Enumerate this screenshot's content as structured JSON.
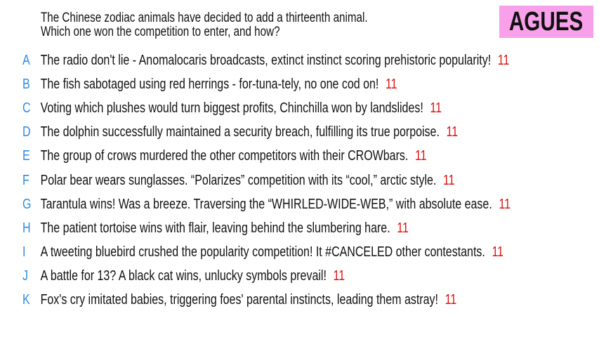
{
  "question": {
    "line1": "The Chinese zodiac animals have decided to add a thirteenth animal.",
    "line2": "Which one won the competition to enter, and how?"
  },
  "badge": {
    "label": "AGUES",
    "color": "#f8a0ea"
  },
  "colors": {
    "letter": "#2e8ae6",
    "score": "#e01010"
  },
  "answers": [
    {
      "letter": "A",
      "text": "The radio don't lie - Anomalocaris broadcasts, extinct instinct scoring prehistoric popularity!",
      "score": "11"
    },
    {
      "letter": "B",
      "text": "The fish sabotaged using red herrings - for-tuna-tely, no one cod on!",
      "score": "11"
    },
    {
      "letter": "C",
      "text": "Voting which plushes would turn biggest profits, Chinchilla won by landslides!",
      "score": "11"
    },
    {
      "letter": "D",
      "text": "The dolphin successfully maintained a security breach, fulfilling its true porpoise.",
      "score": "11"
    },
    {
      "letter": "E",
      "text": "The group of crows murdered the other competitors with their CROWbars.",
      "score": "11"
    },
    {
      "letter": "F",
      "text": "Polar bear wears sunglasses. “Polarizes” competition with its “cool,” arctic style.",
      "score": "11"
    },
    {
      "letter": "G",
      "text": "Tarantula wins! Was a breeze. Traversing the “WHIRLED-WIDE-WEB,” with absolute ease.",
      "score": "11"
    },
    {
      "letter": "H",
      "text": "The patient tortoise wins with flair, leaving behind the slumbering hare.",
      "score": "11"
    },
    {
      "letter": "I",
      "text": "A tweeting bluebird crushed the popularity competition! It #CANCELED other contestants.",
      "score": "11"
    },
    {
      "letter": "J",
      "text": "A battle for 13? A black cat wins, unlucky symbols prevail!",
      "score": "11"
    },
    {
      "letter": "K",
      "text": "Fox's cry imitated babies, triggering foes' parental instincts, leading them astray!",
      "score": "11"
    }
  ]
}
